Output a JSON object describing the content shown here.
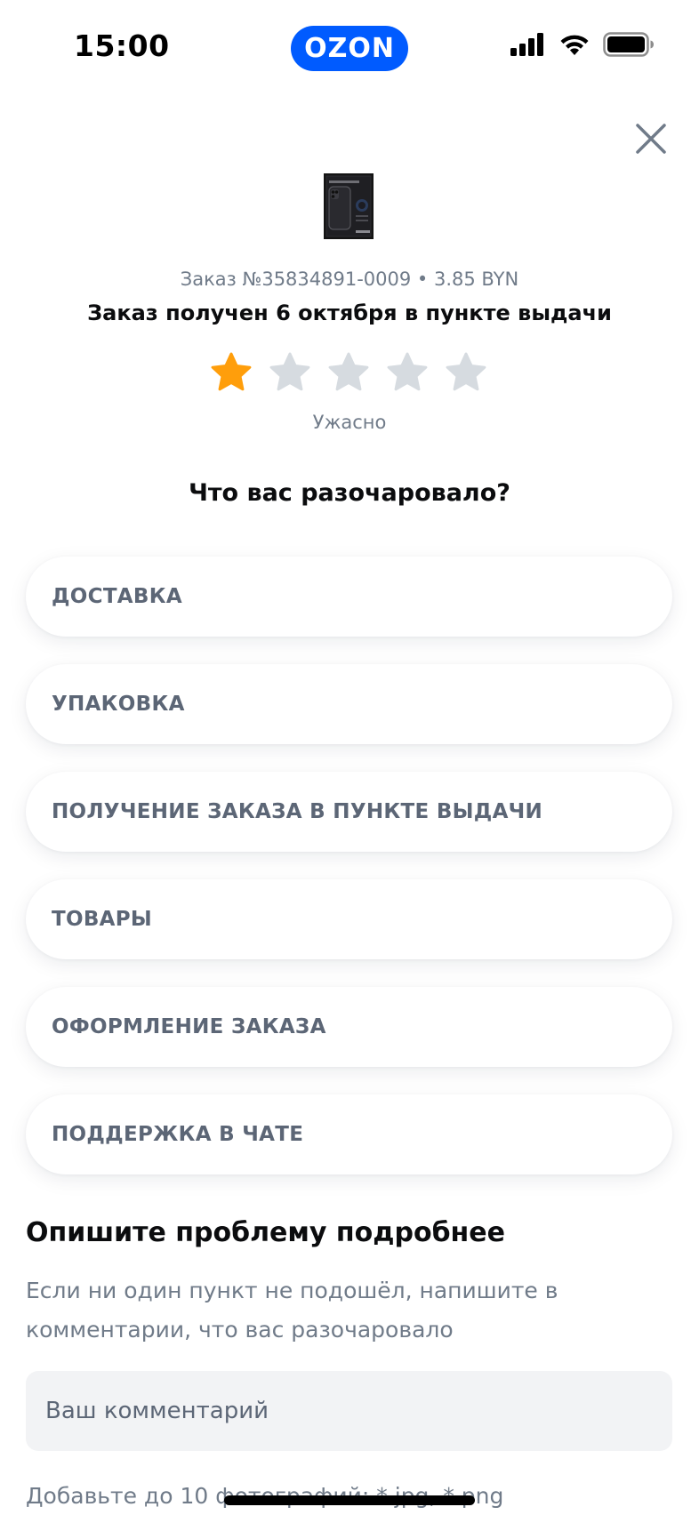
{
  "status_bar": {
    "time": "15:00",
    "brand": "OZON"
  },
  "order": {
    "line": "Заказ №35834891-0009 • 3.85 BYN",
    "status": "Заказ получен 6 октября в пункте выдачи"
  },
  "rating": {
    "value": 1,
    "max": 5,
    "label": "Ужасно"
  },
  "question": "Что вас разочаровало?",
  "options": [
    "ДОСТАВКА",
    "УПАКОВКА",
    "ПОЛУЧЕНИЕ ЗАКАЗА В ПУНКТЕ ВЫДАЧИ",
    "ТОВАРЫ",
    "ОФОРМЛЕНИЕ ЗАКАЗА",
    "ПОДДЕРЖКА В ЧАТЕ"
  ],
  "describe": {
    "title": "Опишите проблему подробнее",
    "hint": "Если ни один пункт не подошёл, напишите в комментарии, что вас разочаровало",
    "comment_placeholder": "Ваш комментарий",
    "comment_value": "",
    "photos_hint": "Добавьте до 10 фотографий: *.jpg, *.png"
  },
  "colors": {
    "brand": "#005bff",
    "star_active": "#ff9e0b",
    "star_inactive": "#d6dbe0",
    "muted_text": "#707b89"
  },
  "icons": {
    "close": "close-icon",
    "star": "star-icon",
    "signal": "signal-icon",
    "wifi": "wifi-icon",
    "battery": "battery-icon"
  }
}
